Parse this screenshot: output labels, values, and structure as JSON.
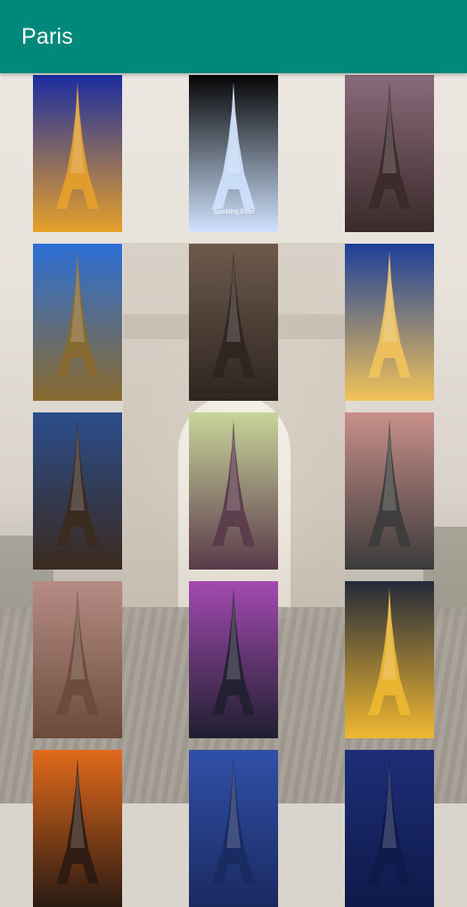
{
  "app": {
    "title": "Paris",
    "accent": "#00897b",
    "title_color": "#ffffff"
  },
  "wallpapers": [
    {
      "name": "eiffel-night-blue",
      "colors": [
        "#1a2ca0",
        "#e7a12a"
      ]
    },
    {
      "name": "eiffel-sparkle-black",
      "colors": [
        "#050505",
        "#cfe3ff"
      ],
      "caption": "Sparkling Eiffel"
    },
    {
      "name": "eiffel-sunset-reflection",
      "colors": [
        "#8a6a7a",
        "#3a2a2a"
      ]
    },
    {
      "name": "eiffel-below-sky",
      "colors": [
        "#2c6fd6",
        "#8a6a2e"
      ]
    },
    {
      "name": "eiffel-sepia-city",
      "colors": [
        "#6e5a4c",
        "#2e2420"
      ]
    },
    {
      "name": "eiffel-dusk-river",
      "colors": [
        "#1b3f9a",
        "#f2c35a"
      ]
    },
    {
      "name": "eiffel-dramatic-sky",
      "colors": [
        "#2b4d8c",
        "#3b2a1e"
      ]
    },
    {
      "name": "eiffel-pastel-scarf",
      "colors": [
        "#c9d59b",
        "#5a3a4a"
      ]
    },
    {
      "name": "eiffel-keychain-hand",
      "colors": [
        "#c98f8a",
        "#3b3b3b"
      ]
    },
    {
      "name": "eiffel-pendant-bokeh",
      "colors": [
        "#b68c84",
        "#6b4a3a"
      ]
    },
    {
      "name": "eiffel-galaxy-pink",
      "colors": [
        "#a34ab0",
        "#1f1f2f"
      ]
    },
    {
      "name": "eiffel-night-lawn",
      "colors": [
        "#242a3a",
        "#f0b830"
      ]
    },
    {
      "name": "eiffel-orange-sunset",
      "colors": [
        "#e26a1c",
        "#2a1a12"
      ]
    },
    {
      "name": "blue-sky-partial",
      "colors": [
        "#3050a8",
        "#1a2a60"
      ]
    },
    {
      "name": "navy-sky-partial",
      "colors": [
        "#1d2e78",
        "#0e1a48"
      ]
    }
  ]
}
